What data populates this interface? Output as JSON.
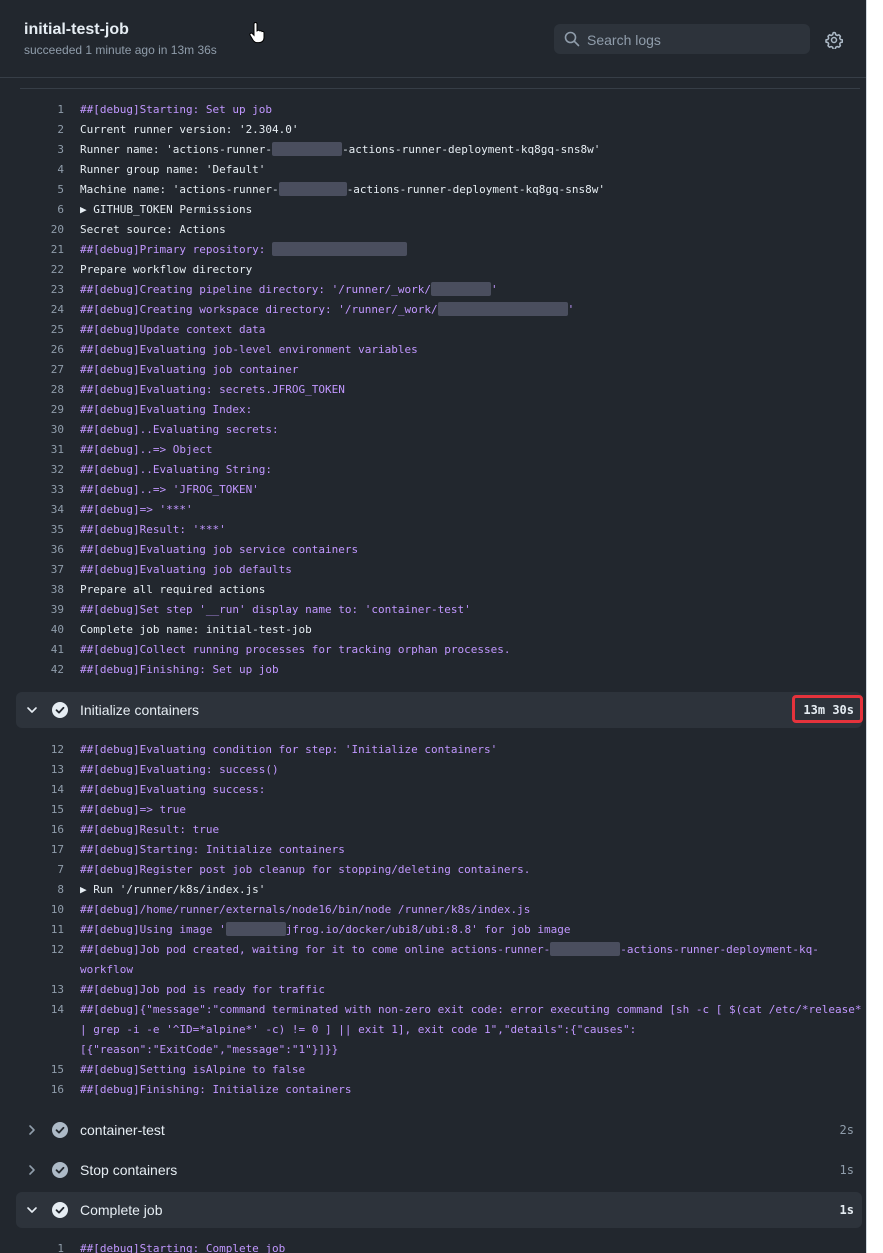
{
  "job": {
    "title": "initial-test-job",
    "status": "succeeded 1 minute ago in 13m 36s"
  },
  "search": {
    "placeholder": "Search logs",
    "value": ""
  },
  "icons": {
    "search": "search-icon",
    "settings": "gear-icon",
    "pointer": "hand-cursor-icon",
    "success": "check-circle-icon",
    "expand": "chevron-icon"
  },
  "colors": {
    "background": "#22272e",
    "debug_text": "#c197ff",
    "highlight": "#e5333c",
    "panel": "#2d333b"
  },
  "setup_log": [
    {
      "n": "1",
      "segs": [
        "##[debug]Starting: Set up job"
      ]
    },
    {
      "n": "2",
      "segs": [
        "Current runner version: '2.304.0'"
      ]
    },
    {
      "n": "3",
      "segs": [
        "Runner name: 'actions-runner-",
        "#R70",
        "-actions-runner-deployment-kq8gq-sns8w'"
      ]
    },
    {
      "n": "4",
      "segs": [
        "Runner group name: 'Default'"
      ]
    },
    {
      "n": "5",
      "segs": [
        "Machine name: 'actions-runner-",
        "#R68",
        "-actions-runner-deployment-kq8gq-sns8w'"
      ]
    },
    {
      "n": "6",
      "segs": [
        "▶ GITHUB_TOKEN Permissions"
      ]
    },
    {
      "n": "20",
      "segs": [
        "Secret source: Actions"
      ]
    },
    {
      "n": "21",
      "segs": [
        "##[debug]Primary repository: ",
        "#R135"
      ]
    },
    {
      "n": "22",
      "segs": [
        "Prepare workflow directory"
      ]
    },
    {
      "n": "23",
      "segs": [
        "##[debug]Creating pipeline directory: '/runner/_work/",
        "#R60",
        "'"
      ]
    },
    {
      "n": "24",
      "segs": [
        "##[debug]Creating workspace directory: '/runner/_work/",
        "#R130",
        "'"
      ]
    },
    {
      "n": "25",
      "segs": [
        "##[debug]Update context data"
      ]
    },
    {
      "n": "26",
      "segs": [
        "##[debug]Evaluating job-level environment variables"
      ]
    },
    {
      "n": "27",
      "segs": [
        "##[debug]Evaluating job container"
      ]
    },
    {
      "n": "28",
      "segs": [
        "##[debug]Evaluating: secrets.JFROG_TOKEN"
      ]
    },
    {
      "n": "29",
      "segs": [
        "##[debug]Evaluating Index:"
      ]
    },
    {
      "n": "30",
      "segs": [
        "##[debug]..Evaluating secrets:"
      ]
    },
    {
      "n": "31",
      "segs": [
        "##[debug]..=> Object"
      ]
    },
    {
      "n": "32",
      "segs": [
        "##[debug]..Evaluating String:"
      ]
    },
    {
      "n": "33",
      "segs": [
        "##[debug]..=> 'JFROG_TOKEN'"
      ]
    },
    {
      "n": "34",
      "segs": [
        "##[debug]=> '***'"
      ]
    },
    {
      "n": "35",
      "segs": [
        "##[debug]Result: '***'"
      ]
    },
    {
      "n": "36",
      "segs": [
        "##[debug]Evaluating job service containers"
      ]
    },
    {
      "n": "37",
      "segs": [
        "##[debug]Evaluating job defaults"
      ]
    },
    {
      "n": "38",
      "segs": [
        "Prepare all required actions"
      ]
    },
    {
      "n": "39",
      "segs": [
        "##[debug]Set step '__run' display name to: 'container-test'"
      ]
    },
    {
      "n": "40",
      "segs": [
        "Complete job name: initial-test-job"
      ]
    },
    {
      "n": "41",
      "segs": [
        "##[debug]Collect running processes for tracking orphan processes."
      ]
    },
    {
      "n": "42",
      "segs": [
        "##[debug]Finishing: Set up job"
      ]
    }
  ],
  "steps": [
    {
      "name": "Initialize containers",
      "duration": "13m 30s",
      "expanded": true
    },
    {
      "name": "container-test",
      "duration": "2s",
      "expanded": false
    },
    {
      "name": "Stop containers",
      "duration": "1s",
      "expanded": false
    },
    {
      "name": "Complete job",
      "duration": "1s",
      "expanded": true
    }
  ],
  "init_log": [
    {
      "n": "12",
      "segs": [
        "##[debug]Evaluating condition for step: 'Initialize containers'"
      ]
    },
    {
      "n": "13",
      "segs": [
        "##[debug]Evaluating: success()"
      ]
    },
    {
      "n": "14",
      "segs": [
        "##[debug]Evaluating success:"
      ]
    },
    {
      "n": "15",
      "segs": [
        "##[debug]=> true"
      ]
    },
    {
      "n": "16",
      "segs": [
        "##[debug]Result: true"
      ]
    },
    {
      "n": "17",
      "segs": [
        "##[debug]Starting: Initialize containers"
      ]
    },
    {
      "n": "7",
      "segs": [
        "##[debug]Register post job cleanup for stopping/deleting containers."
      ]
    },
    {
      "n": "8",
      "segs": [
        "▶ Run '/runner/k8s/index.js'"
      ]
    },
    {
      "n": "10",
      "segs": [
        "##[debug]/home/runner/externals/node16/bin/node /runner/k8s/index.js"
      ]
    },
    {
      "n": "11",
      "segs": [
        "##[debug]Using image '",
        "#R60",
        "jfrog.io/docker/ubi8/ubi:8.8' for job image"
      ]
    },
    {
      "n": "12",
      "segs": [
        "##[debug]Job pod created, waiting for it to come online actions-runner-",
        "#R70",
        "-actions-runner-deployment-kq-"
      ]
    },
    {
      "n": "",
      "segs": [
        "workflow"
      ]
    },
    {
      "n": "13",
      "segs": [
        "##[debug]Job pod is ready for traffic"
      ]
    },
    {
      "n": "14",
      "segs": [
        "##[debug]{\"message\":\"command terminated with non-zero exit code: error executing command [sh -c [ $(cat /etc/*release*"
      ]
    },
    {
      "n": "",
      "segs": [
        "| grep -i -e '^ID=*alpine*' -c) != 0 ] || exit 1], exit code 1\",\"details\":{\"causes\":"
      ]
    },
    {
      "n": "",
      "segs": [
        "[{\"reason\":\"ExitCode\",\"message\":\"1\"}]}}"
      ]
    },
    {
      "n": "15",
      "segs": [
        "##[debug]Setting isAlpine to false"
      ]
    },
    {
      "n": "16",
      "segs": [
        "##[debug]Finishing: Initialize containers"
      ]
    }
  ],
  "complete_log": [
    {
      "n": "1",
      "segs": [
        "##[debug]Starting: Complete job"
      ]
    }
  ]
}
